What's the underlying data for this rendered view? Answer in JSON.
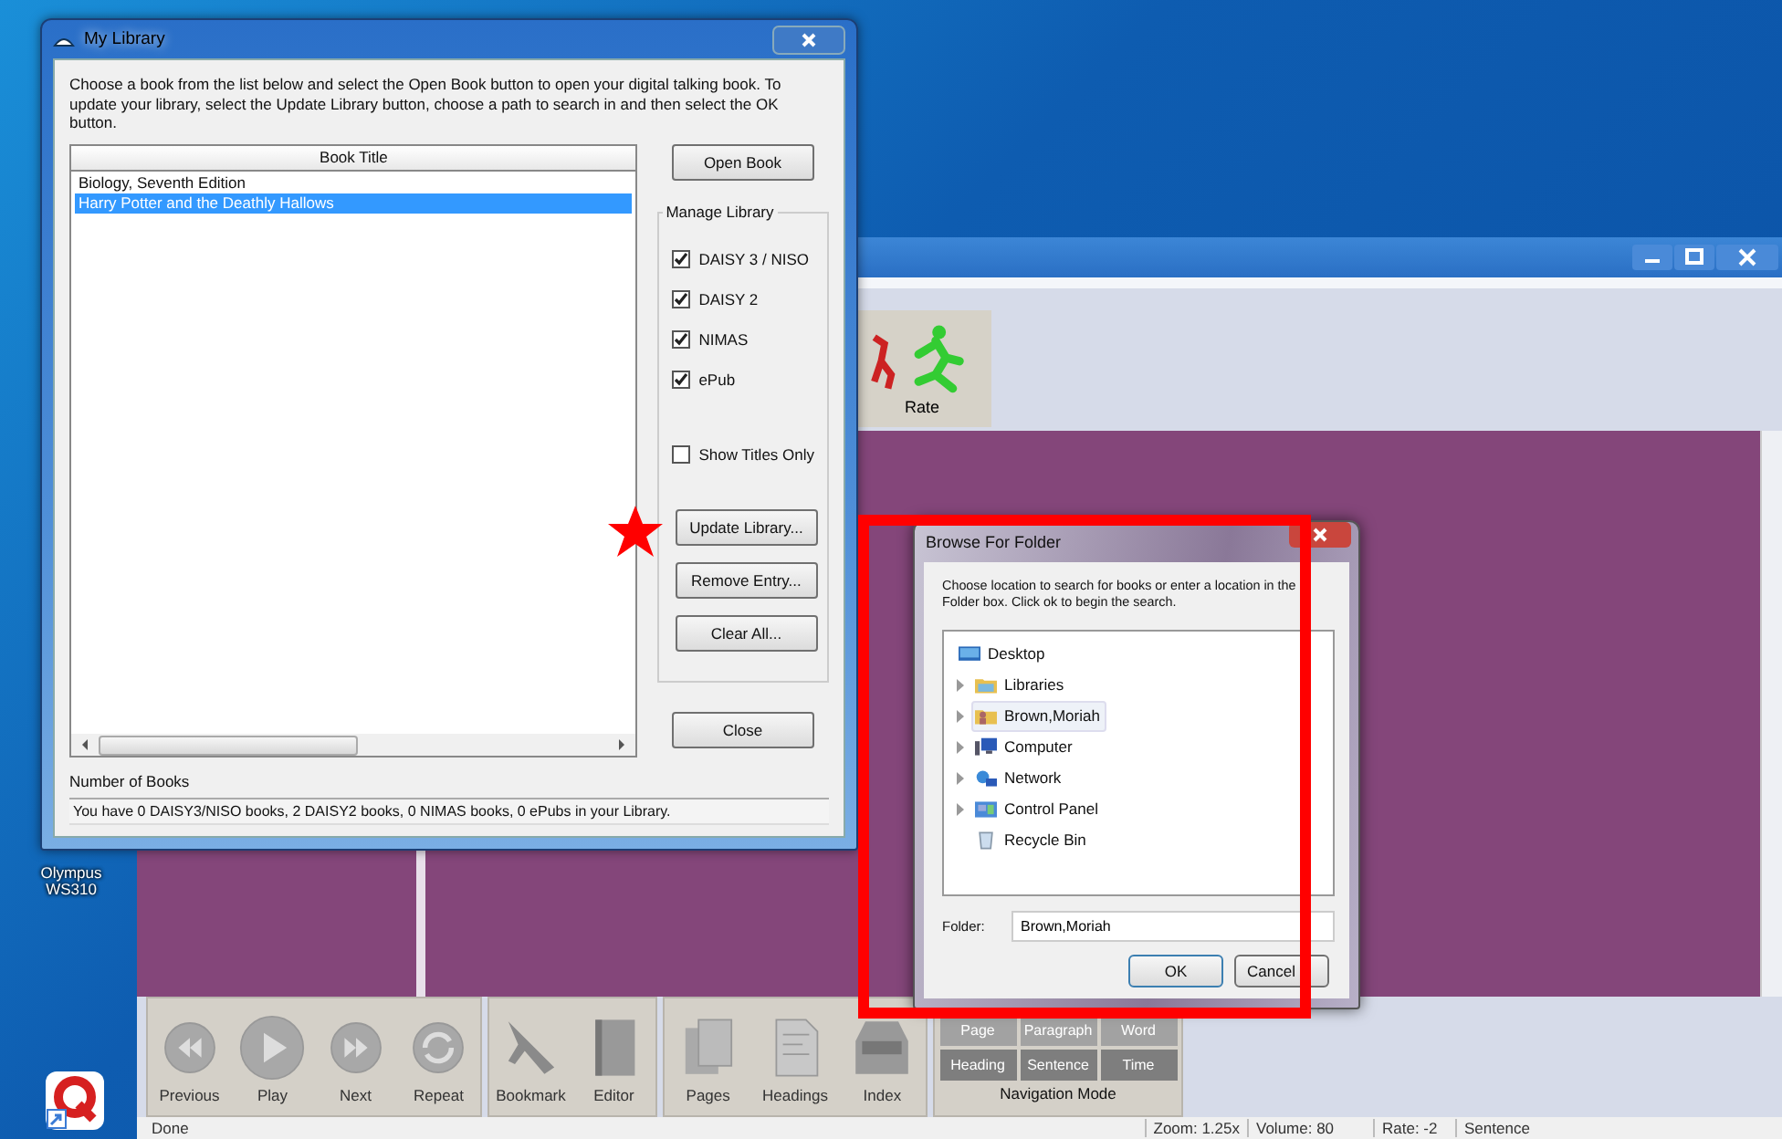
{
  "desktop": {
    "shortcut": {
      "label": "Olympus WS310"
    }
  },
  "reader_window": {
    "toolbar": [
      {
        "label": "Rate",
        "kind": "rate"
      }
    ],
    "transport": [
      {
        "label": "Previous",
        "kind": "previous"
      },
      {
        "label": "Play",
        "kind": "play"
      },
      {
        "label": "Next",
        "kind": "next"
      },
      {
        "label": "Repeat",
        "kind": "repeat"
      }
    ],
    "tools": [
      {
        "label": "Bookmark",
        "kind": "bookmark"
      },
      {
        "label": "Editor",
        "kind": "editor"
      }
    ],
    "navigate": [
      {
        "label": "Pages",
        "kind": "pages"
      },
      {
        "label": "Headings",
        "kind": "headings"
      },
      {
        "label": "Index",
        "kind": "index"
      }
    ],
    "navigation_mode": {
      "label": "Navigation Mode",
      "modes": [
        {
          "label": "Page",
          "disabled": true
        },
        {
          "label": "Paragraph",
          "disabled": true
        },
        {
          "label": "Word",
          "disabled": true
        },
        {
          "label": "Heading",
          "disabled": false
        },
        {
          "label": "Sentence",
          "disabled": false
        },
        {
          "label": "Time",
          "disabled": false
        }
      ]
    },
    "status_bar": {
      "message": "Done",
      "fields": [
        "Zoom: 1.25x",
        "Volume: 80",
        "Rate: -2",
        "Sentence"
      ]
    }
  },
  "library_dialog": {
    "title": "My Library",
    "instructions": "Choose a book from the list below and select the Open Book button to open your digital talking book.  To update your library, select the Update Library button, choose a path to search in and then select the OK button.",
    "table": {
      "columns": [
        "Book Title"
      ],
      "rows": [
        {
          "title": "Biology, Seventh Edition",
          "selected": false
        },
        {
          "title": "Harry Potter and the Deathly Hallows",
          "selected": true
        }
      ]
    },
    "open_button": "Open Book",
    "manage_library": {
      "label": "Manage Library",
      "formats": [
        {
          "label": "DAISY 3 / NISO",
          "checked": true
        },
        {
          "label": "DAISY 2",
          "checked": true
        },
        {
          "label": "NIMAS",
          "checked": true
        },
        {
          "label": "ePub",
          "checked": true
        }
      ],
      "show_titles_only": {
        "label": "Show Titles Only",
        "checked": false
      },
      "buttons": [
        "Update Library...",
        "Remove Entry...",
        "Clear All..."
      ]
    },
    "close_button": "Close",
    "summary": {
      "label": "Number of Books",
      "text": "You have 0 DAISY3/NISO books, 2 DAISY2 books, 0 NIMAS books, 0 ePubs in your Library."
    }
  },
  "folder_dialog": {
    "title": "Browse For Folder",
    "instructions": "Choose location to search for books or enter a location in the Folder box.  Click ok to begin the search.",
    "tree": [
      {
        "label": "Desktop",
        "kind": "desktop",
        "selected": false,
        "children": [
          {
            "label": "Libraries",
            "kind": "libraries",
            "selected": false,
            "expandable": true
          },
          {
            "label": "Brown,Moriah",
            "kind": "user",
            "selected": true,
            "expandable": true
          },
          {
            "label": "Computer",
            "kind": "computer",
            "selected": false,
            "expandable": true
          },
          {
            "label": "Network",
            "kind": "network",
            "selected": false,
            "expandable": true
          },
          {
            "label": "Control Panel",
            "kind": "control-panel",
            "selected": false,
            "expandable": true
          },
          {
            "label": "Recycle Bin",
            "kind": "recycle-bin",
            "selected": false,
            "expandable": false
          }
        ]
      }
    ],
    "folder_field": {
      "label": "Folder:",
      "value": "Brown,Moriah"
    },
    "buttons": [
      "OK",
      "Cancel"
    ]
  }
}
